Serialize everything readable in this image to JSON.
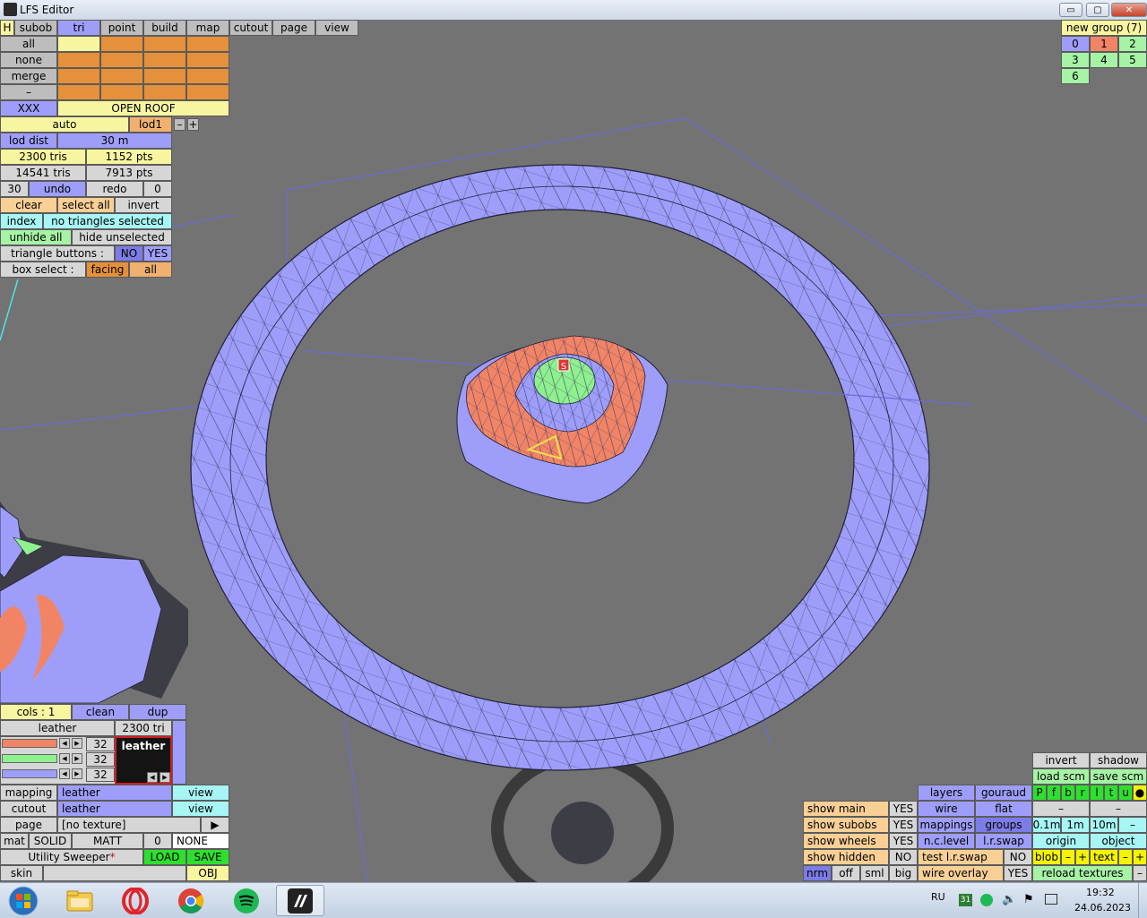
{
  "window": {
    "title": "LFS Editor",
    "buttons": {
      "minimize": "▭",
      "maximize": "▢",
      "close": "✕"
    }
  },
  "top_tabs": {
    "h": "H",
    "subob": "subob",
    "tri": "tri",
    "point": "point",
    "build": "build",
    "map": "map",
    "cutout": "cutout",
    "page": "page",
    "view": "view"
  },
  "left_panel": {
    "all": "all",
    "none": "none",
    "merge": "merge",
    "dash": "–",
    "xxx": "XXX",
    "open_roof": "OPEN ROOF",
    "auto": "auto",
    "lod1": "lod1",
    "minus": "–",
    "plus": "+",
    "lod_dist": "lod dist",
    "lod_dist_val": "30 m",
    "tris1": "2300 tris",
    "pts1": "1152 pts",
    "tris2": "14541 tris",
    "pts2": "7913 pts",
    "num30": "30",
    "undo": "undo",
    "redo": "redo",
    "num0": "0",
    "clear": "clear",
    "select_all": "select all",
    "invert": "invert",
    "index": "index",
    "no_tri_sel": "no triangles selected",
    "unhide_all": "unhide all",
    "hide_unsel": "hide unselected",
    "tri_buttons": "triangle buttons :",
    "no": "NO",
    "yes": "YES",
    "box_select": "box select :",
    "facing": "facing",
    "all2": "all"
  },
  "group_panel": {
    "title": "new group (7)",
    "groups": [
      "0",
      "1",
      "2",
      "3",
      "4",
      "5",
      "6"
    ]
  },
  "viewport": {
    "marker": "S"
  },
  "material_panel": {
    "cols": "cols : 1",
    "clean": "clean",
    "dup": "dup",
    "leather": "leather",
    "tri_count": "2300 tri",
    "val1": "32",
    "val2": "32",
    "val3": "32",
    "swatch_label": "leather",
    "mapping": "mapping",
    "mapping_val": "leather",
    "view1": "view",
    "cutout": "cutout",
    "cutout_val": "leather",
    "view2": "view",
    "page": "page",
    "page_val": "[no texture]",
    "play": "▶",
    "mat": "mat",
    "solid": "SOLID",
    "matt": "MATT",
    "zero": "0",
    "none": "NONE",
    "utility": "Utility Sweeper",
    "asterisk": "*",
    "load": "LOAD",
    "save": "SAVE",
    "skin": "skin",
    "obj": "OBJ"
  },
  "right_panel": {
    "invert": "invert",
    "shadow": "shadow",
    "load_scm": "load scm",
    "save_scm": "save scm",
    "layer_letters": [
      "P",
      "f",
      "b",
      "r",
      "l",
      "t",
      "u",
      "●"
    ],
    "dash1": "–",
    "dash2": "–",
    "layers": "layers",
    "gouraud": "gouraud",
    "wire": "wire",
    "flat": "flat",
    "mappings": "mappings",
    "groups": "groups",
    "n_c_level": "n.c.level",
    "l_r_swap": "l.r.swap",
    "test_lr": "test l.r.swap",
    "no": "NO",
    "wire_overlay": "wire overlay",
    "yes": "YES",
    "show_main": "show main",
    "show_subobs": "show subobs",
    "show_wheels": "show wheels",
    "show_hidden": "show hidden",
    "yes1": "YES",
    "yes2": "YES",
    "yes3": "YES",
    "no2": "NO",
    "nrm": "nrm",
    "off": "off",
    "sml": "sml",
    "big": "big",
    "d01": "0.1m",
    "d1": "1m",
    "d10": "10m",
    "dm": "–",
    "origin": "origin",
    "object": "object",
    "blob": "blob",
    "bm": "–",
    "bp": "+",
    "text": "text",
    "tm": "–",
    "tp": "+",
    "reload": "reload textures",
    "rm": "–"
  },
  "taskbar": {
    "lang": "RU",
    "calendar": "31",
    "time": "19:32",
    "date": "24.06.2023"
  }
}
